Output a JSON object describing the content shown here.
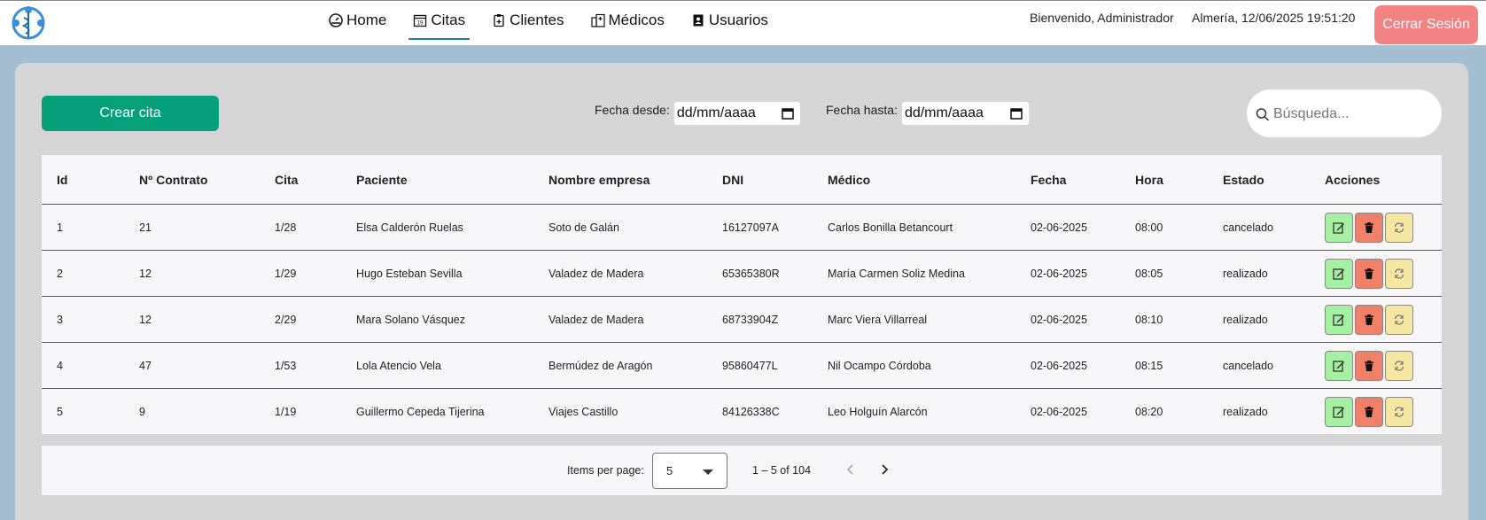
{
  "header": {
    "logo_icon": "medical-caduceus-icon",
    "nav": [
      {
        "label": "Home",
        "icon": "dashboard-gauge-icon"
      },
      {
        "label": "Citas",
        "icon": "calendar-icon",
        "active": true
      },
      {
        "label": "Clientes",
        "icon": "clipboard-icon"
      },
      {
        "label": "Médicos",
        "icon": "hospital-icon"
      },
      {
        "label": "Usuarios",
        "icon": "contact-book-icon"
      }
    ],
    "welcome": "Bienvenido, Administrador",
    "datetime": "Almería, 12/06/2025 19:51:20",
    "logout_label": "Cerrar Sesión"
  },
  "toolbar": {
    "create_label": "Crear cita",
    "date_from_label": "Fecha desde:",
    "date_from_value": "dd/mm/aaaa",
    "date_to_label": "Fecha hasta:",
    "date_to_value": "dd/mm/aaaa",
    "search_placeholder": "Búsqueda..."
  },
  "table": {
    "columns": [
      "Id",
      "Nº Contrato",
      "Cita",
      "Paciente",
      "Nombre empresa",
      "DNI",
      "Médico",
      "Fecha",
      "Hora",
      "Estado",
      "Acciones"
    ],
    "rows": [
      [
        "1",
        "21",
        "1/28",
        "Elsa Calderón Ruelas",
        "Soto de Galán",
        "16127097A",
        "Carlos Bonilla Betancourt",
        "02-06-2025",
        "08:00",
        "cancelado"
      ],
      [
        "2",
        "12",
        "1/29",
        "Hugo Esteban Sevilla",
        "Valadez de Madera",
        "65365380R",
        "María Carmen Soliz Medina",
        "02-06-2025",
        "08:05",
        "realizado"
      ],
      [
        "3",
        "12",
        "2/29",
        "Mara Solano Vásquez",
        "Valadez de Madera",
        "68733904Z",
        "Marc Viera Villarreal",
        "02-06-2025",
        "08:10",
        "realizado"
      ],
      [
        "4",
        "47",
        "1/53",
        "Lola Atencio Vela",
        "Bermúdez de Aragón",
        "95860477L",
        "Nil Ocampo Córdoba",
        "02-06-2025",
        "08:15",
        "cancelado"
      ],
      [
        "5",
        "9",
        "1/19",
        "Guillermo Cepeda Tijerina",
        "Viajes Castillo",
        "84126338C",
        "Leo Holguín Alarcón",
        "02-06-2025",
        "08:20",
        "realizado"
      ]
    ],
    "actions": {
      "edit_icon": "edit-icon",
      "delete_icon": "trash-icon",
      "sync_icon": "refresh-icon"
    }
  },
  "paginator": {
    "items_per_page_label": "Items per page:",
    "items_per_page_value": "5",
    "range": "1 – 5 of 104"
  },
  "colors": {
    "primary_green": "#06a07a",
    "logout_red": "#f38383",
    "edit_green": "#a6f0a3",
    "delete_red": "#f08068",
    "sync_yellow": "#f6e8a0",
    "active_tab": "#1976d2"
  }
}
